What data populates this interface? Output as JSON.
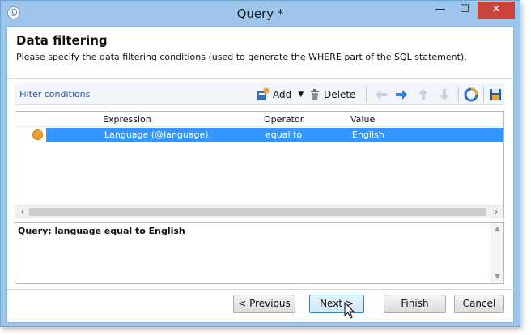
{
  "window": {
    "title": "Query *",
    "app_icon_glyph": "@",
    "minimize_glyph": "—",
    "maximize_glyph": "☐",
    "close_glyph": "✕"
  },
  "page": {
    "heading": "Data filtering",
    "description": "Please specify the data filtering conditions (used to generate the WHERE part of the SQL statement)."
  },
  "toolbar": {
    "label": "Filter conditions",
    "add_label": "Add",
    "delete_label": "Delete"
  },
  "grid": {
    "columns": [
      "Expression",
      "Operator",
      "Value"
    ],
    "rows": [
      {
        "expression": "Language (@language)",
        "operator": "equal to",
        "value": "English"
      }
    ],
    "scroll_left_glyph": "‹",
    "scroll_right_glyph": "›"
  },
  "query": {
    "text": "Query: language equal to English",
    "scroll_up_glyph": "▲",
    "scroll_down_glyph": "▼"
  },
  "buttons": {
    "previous": "< Previous",
    "next": "Next >",
    "finish": "Finish",
    "cancel": "Cancel"
  },
  "colors": {
    "selection": "#3397ff",
    "accent": "#2a58a0",
    "close": "#c7443a",
    "row_dot": "#f3a12a"
  }
}
